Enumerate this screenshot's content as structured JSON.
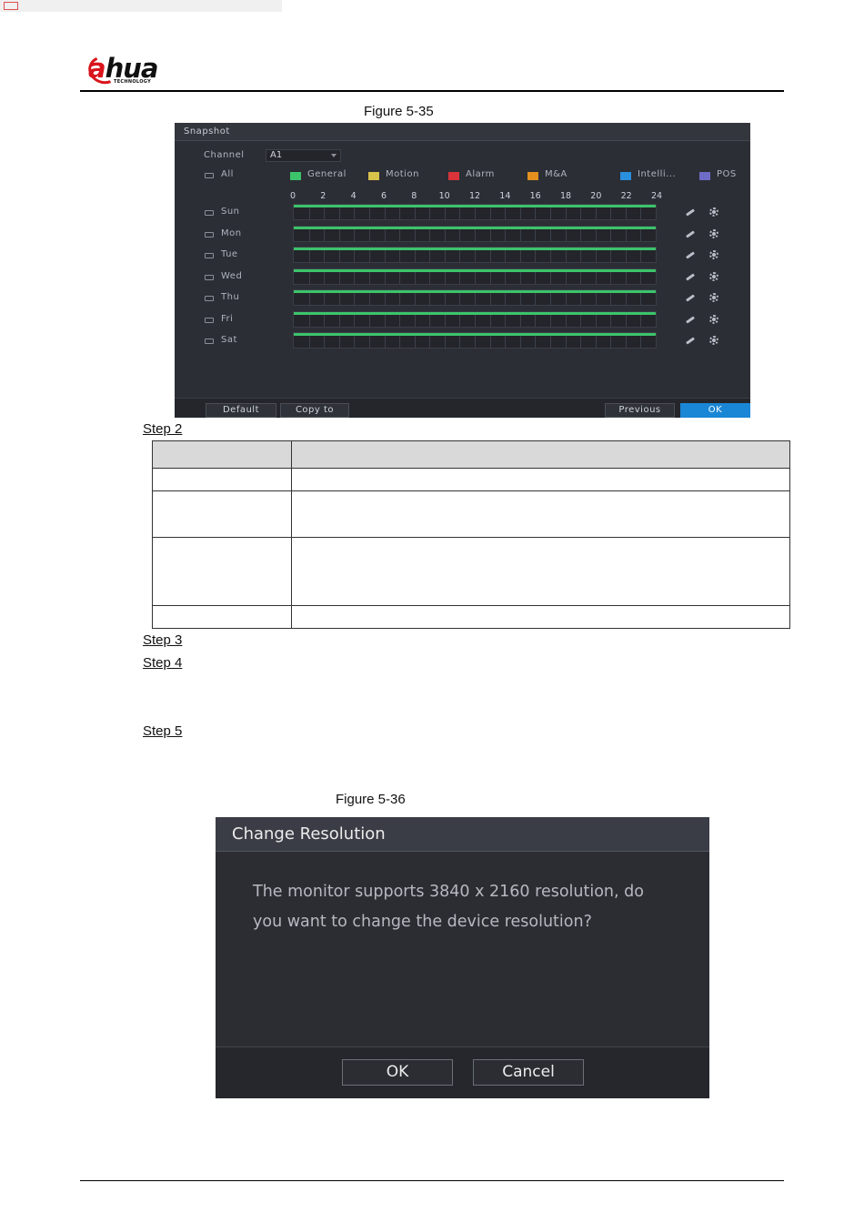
{
  "brand": {
    "name_red": "a",
    "name_rest": "hua",
    "sub": "TECHNOLOGY"
  },
  "figures": {
    "fig1": "Figure 5-35",
    "fig2": "Figure 5-36"
  },
  "steps": [
    "Step 2",
    "Step 3",
    "Step 4",
    "Step 5"
  ],
  "snapshot": {
    "title": "Snapshot",
    "channel_label": "Channel",
    "channel_value": "A1",
    "all_label": "All",
    "legend": [
      {
        "label": "General",
        "color": "#3cc46b"
      },
      {
        "label": "Motion",
        "color": "#d8c24a"
      },
      {
        "label": "Alarm",
        "color": "#d9343a"
      },
      {
        "label": "M&A",
        "color": "#e3901e"
      },
      {
        "label": "Intelli...",
        "color": "#2a8fdc"
      },
      {
        "label": "POS",
        "color": "#6f6cc8"
      }
    ],
    "ticks": [
      "0",
      "2",
      "4",
      "6",
      "8",
      "10",
      "12",
      "14",
      "16",
      "18",
      "20",
      "22",
      "24"
    ],
    "days": [
      "Sun",
      "Mon",
      "Tue",
      "Wed",
      "Thu",
      "Fri",
      "Sat"
    ],
    "buttons": {
      "default": "Default",
      "copy": "Copy to",
      "previous": "Previous",
      "ok": "OK"
    }
  },
  "dialog": {
    "title": "Change Resolution",
    "line1": "The monitor supports 3840 x 2160 resolution, do",
    "line2": "you want to change the device resolution?",
    "ok": "OK",
    "cancel": "Cancel"
  }
}
